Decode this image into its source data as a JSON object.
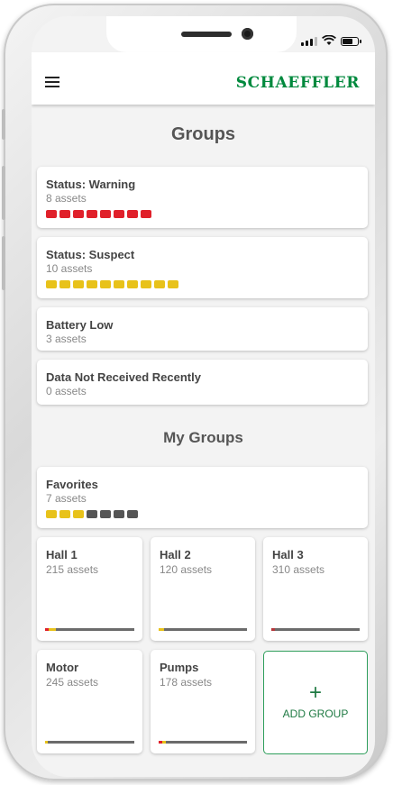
{
  "app": {
    "brand": "SCHAEFFLER"
  },
  "sections": {
    "groups_title": "Groups",
    "my_groups_title": "My Groups"
  },
  "groups": [
    {
      "title": "Status: Warning",
      "subtitle": "8 assets",
      "icon_color": "#e0202a"
    },
    {
      "title": "Status: Suspect",
      "subtitle": "10 assets",
      "icon_color": "#e8c21a"
    },
    {
      "title": "Battery Low",
      "subtitle": "3 assets"
    },
    {
      "title": "Data Not Received Recently",
      "subtitle": "0 assets"
    }
  ],
  "favorites": {
    "title": "Favorites",
    "subtitle": "7 assets",
    "icon_colors": [
      "#e8c21a",
      "#e8c21a",
      "#e8c21a",
      "#555555",
      "#555555",
      "#555555",
      "#555555"
    ]
  },
  "tiles": [
    {
      "title": "Hall 1",
      "subtitle": "215 assets",
      "accent": "#e0202a",
      "accent2": "#e8c21a"
    },
    {
      "title": "Hall 2",
      "subtitle": "120 assets",
      "accent": "#e8c21a",
      "accent2": "#e8c21a"
    },
    {
      "title": "Hall 3",
      "subtitle": "310 assets",
      "accent": "#b5383c",
      "accent2": "#b5383c"
    },
    {
      "title": "Motor",
      "subtitle": "245 assets",
      "accent": "#e8c21a",
      "accent2": "#e8c21a"
    },
    {
      "title": "Pumps",
      "subtitle": "178 assets",
      "accent": "#e0202a",
      "accent2": "#e8c21a"
    }
  ],
  "add_group": {
    "icon": "+",
    "label": "ADD GROUP"
  },
  "colors": {
    "brand": "#00893d",
    "warning": "#e0202a",
    "suspect": "#e8c21a",
    "add_border": "#2e9e5b"
  }
}
